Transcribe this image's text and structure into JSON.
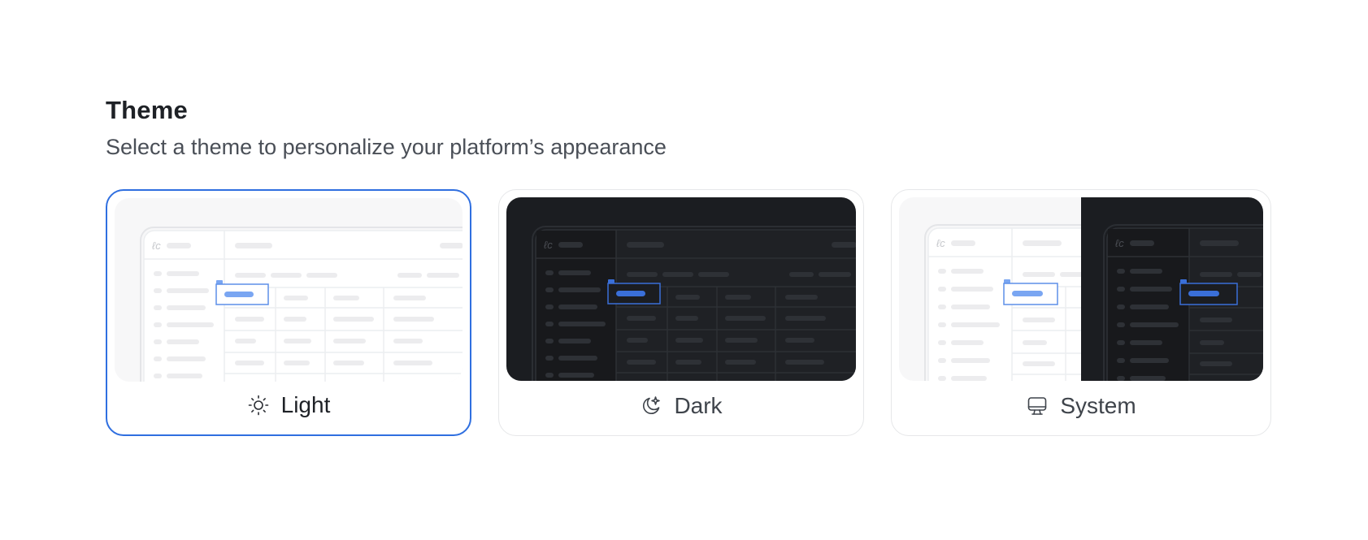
{
  "header": {
    "title": "Theme",
    "subtitle": "Select a theme to personalize your platform’s appearance"
  },
  "themes": [
    {
      "id": "light",
      "label": "Light",
      "icon": "sun-icon",
      "selected": true
    },
    {
      "id": "dark",
      "label": "Dark",
      "icon": "moon-stars-icon",
      "selected": false
    },
    {
      "id": "system",
      "label": "System",
      "icon": "monitor-icon",
      "selected": false
    }
  ],
  "colors": {
    "accent": "#2f6fe0",
    "light_bg": "#f7f7f8",
    "dark_bg": "#1b1d21"
  }
}
